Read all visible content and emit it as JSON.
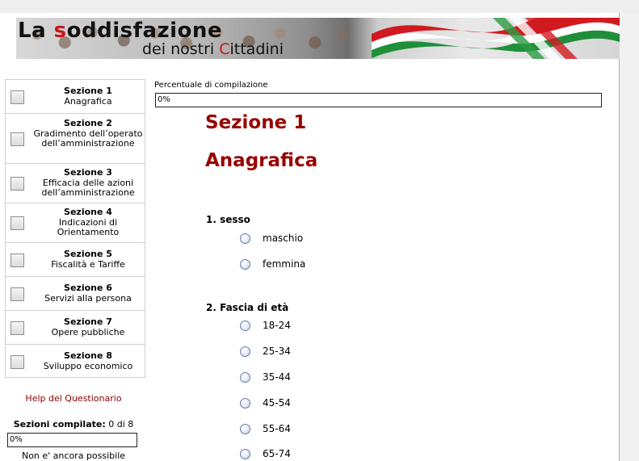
{
  "banner": {
    "brand_line1_pre": "La ",
    "brand_line1_accent": "s",
    "brand_line1_post": "oddisfazione",
    "brand_line2_pre": "dei nostri ",
    "brand_line2_accent": "C",
    "brand_line2_post": "ittadini"
  },
  "sidebar": {
    "items": [
      {
        "title": "Sezione 1",
        "subtitle": "Anagrafica"
      },
      {
        "title": "Sezione 2",
        "subtitle": "Gradimento dell’operato dell’amministrazione"
      },
      {
        "title": "Sezione 3",
        "subtitle": "Efficacia delle azioni dell’amministrazione"
      },
      {
        "title": "Sezione 4",
        "subtitle": "Indicazioni di Orientamento"
      },
      {
        "title": "Sezione 5",
        "subtitle": "Fiscalità e Tariffe"
      },
      {
        "title": "Sezione 6",
        "subtitle": "Servizi alla persona"
      },
      {
        "title": "Sezione 7",
        "subtitle": "Opere pubbliche"
      },
      {
        "title": "Sezione 8",
        "subtitle": "Sviluppo economico"
      }
    ],
    "help_link": "Help del Questionario",
    "completed_label": "Sezioni compilate:",
    "completed_value": "0 di 8",
    "completed_progress": "0%",
    "not_yet_text": "Non e' ancora possibile"
  },
  "main": {
    "progress_label": "Percentuale di compilazione",
    "progress_value": "0%",
    "section_title": "Sezione 1",
    "section_subtitle": "Anagrafica",
    "questions": [
      {
        "label": "1. sesso",
        "options": [
          "maschio",
          "femmina"
        ]
      },
      {
        "label": "2. Fascia di età",
        "options": [
          "18-24",
          "25-34",
          "35-44",
          "45-54",
          "55-64",
          "65-74"
        ]
      }
    ]
  },
  "colors": {
    "section_title": "#990000",
    "help_link": "#8b0000",
    "brand_accent": "#c8151b"
  }
}
